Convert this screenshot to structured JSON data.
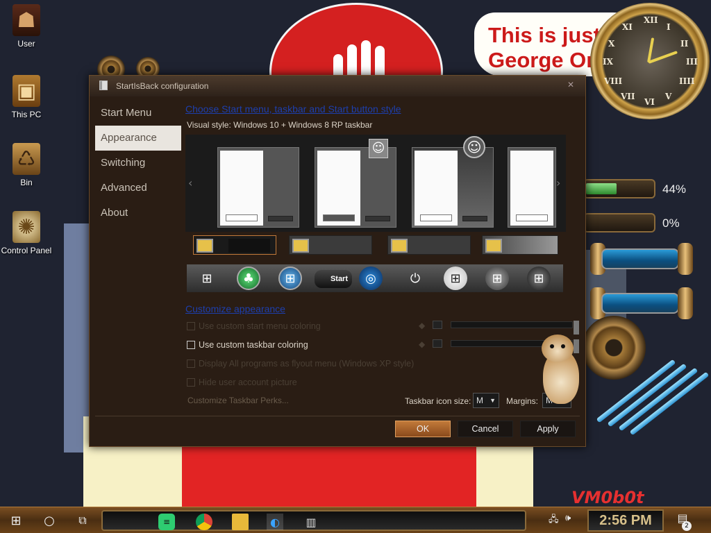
{
  "desktop_icons": [
    {
      "label": "User",
      "icon": "user-folder-icon"
    },
    {
      "label": "This PC",
      "icon": "computer-icon"
    },
    {
      "label": "Bin",
      "icon": "recycle-bin-icon"
    },
    {
      "label": "Control Panel",
      "icon": "control-panel-icon"
    }
  ],
  "background": {
    "quote_line1": "This is just...",
    "quote_line2": "George Orwell...",
    "signature": "VM0b0t",
    "clock_numerals": [
      "XII",
      "I",
      "II",
      "III",
      "IIII",
      "V",
      "VI",
      "VII",
      "VIII",
      "IX",
      "X",
      "XI"
    ]
  },
  "gauges": [
    {
      "label": "44%",
      "value": 44
    },
    {
      "label": "0%",
      "value": 0
    }
  ],
  "window": {
    "title": "StartIsBack configuration",
    "close_icon": "close-icon",
    "nav": [
      "Start Menu",
      "Appearance",
      "Switching",
      "Advanced",
      "About"
    ],
    "active_nav": "Appearance",
    "section1_title": "Choose Start menu, taskbar and Start button style",
    "visual_style_label": "Visual style:",
    "visual_style_value": "Windows 10 + Windows 8 RP taskbar",
    "start_button_label": "Start",
    "section2_title": "Customize appearance",
    "options": [
      {
        "label": "Use custom start menu coloring",
        "enabled": false,
        "checked": false
      },
      {
        "label": "Use custom taskbar coloring",
        "enabled": true,
        "checked": false
      },
      {
        "label": "Display All programs as flyout menu (Windows XP style)",
        "enabled": false,
        "checked": false
      },
      {
        "label": "Hide user account picture",
        "enabled": false,
        "checked": false
      }
    ],
    "perks_link": "Customize Taskbar Perks...",
    "icon_size_label": "Taskbar icon size:",
    "icon_size_value": "M",
    "margins_label": "Margins:",
    "margins_value": "M",
    "buttons": {
      "ok": "OK",
      "cancel": "Cancel",
      "apply": "Apply"
    }
  },
  "taskbar": {
    "apps": [
      "windows-start-icon",
      "cortana-icon",
      "task-view-icon",
      "chat-app-icon",
      "chrome-icon",
      "file-explorer-icon",
      "paint-app-icon",
      "startisback-app-icon"
    ],
    "clock": "2:56 PM",
    "notifications_count": "2"
  },
  "colors": {
    "window_bg": "#2a1d14",
    "accent": "#c27a3a",
    "section_title": "#1d3fae",
    "quote_text": "#cc1a1a"
  }
}
